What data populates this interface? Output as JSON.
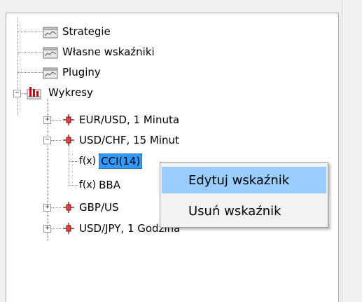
{
  "tree": {
    "strategies": "Strategie",
    "own_indicators": "Własne wskaźniki",
    "plugins": "Pluginy",
    "charts": "Wykresy",
    "chart_items": [
      {
        "label": "EUR/USD, 1 Minuta",
        "expanded": false
      },
      {
        "label": "USD/CHF, 15 Minut",
        "expanded": true,
        "children": [
          {
            "prefix": "f(x)",
            "label": "CCI(14)",
            "selected": true
          },
          {
            "prefix": "f(x)",
            "label": "BBA"
          }
        ]
      },
      {
        "label": "GBP/US",
        "expanded": false
      },
      {
        "label": "USD/JPY, 1 Godzina",
        "expanded": false
      }
    ]
  },
  "context_menu": {
    "edit": "Edytuj wskaźnik",
    "delete": "Usuń wskaźnik"
  },
  "colors": {
    "selection": "#3399ff",
    "menu_hover": "#99ccff",
    "chart_icon": "#c00000"
  }
}
